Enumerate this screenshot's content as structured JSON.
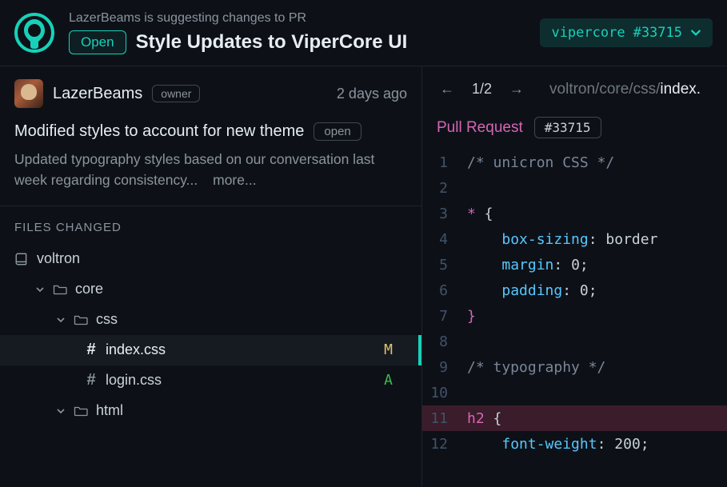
{
  "header": {
    "suggest_line": "LazerBeams is suggesting changes to PR",
    "open_label": "Open",
    "title": "Style Updates to ViperCore UI",
    "branch_name": "vipercore",
    "branch_number": "#33715"
  },
  "author": {
    "name": "LazerBeams",
    "role": "owner",
    "timestamp": "2 days ago"
  },
  "commit": {
    "title": "Modified styles to account for new theme",
    "status": "open",
    "description": "Updated typography styles based on our conversation last week regarding consistency...",
    "more_label": "more..."
  },
  "files": {
    "heading": "FILES CHANGED",
    "tree": {
      "repo": "voltron",
      "core": "core",
      "css": "css",
      "html": "html",
      "index_css": "index.css",
      "login_css": "login.css",
      "index_status": "M",
      "login_status": "A"
    }
  },
  "code_panel": {
    "nav": {
      "prev": "←",
      "counter": "1/2",
      "next": "→",
      "path_prefix": "voltron/core/css/",
      "path_file": "index."
    },
    "pr_label": "Pull Request",
    "pr_number": "#33715",
    "lines": [
      {
        "n": 1,
        "indent": 0,
        "tokens": [
          {
            "c": "tok-comment",
            "t": "/* unicron CSS */"
          }
        ]
      },
      {
        "n": 2,
        "indent": 0,
        "tokens": []
      },
      {
        "n": 3,
        "indent": 0,
        "tokens": [
          {
            "c": "tok-sel",
            "t": "*"
          },
          {
            "c": "tok-punc",
            "t": " {"
          }
        ]
      },
      {
        "n": 4,
        "indent": 1,
        "tokens": [
          {
            "c": "tok-prop",
            "t": "box-sizing"
          },
          {
            "c": "tok-punc",
            "t": ": "
          },
          {
            "c": "tok-val",
            "t": "border"
          }
        ]
      },
      {
        "n": 5,
        "indent": 1,
        "tokens": [
          {
            "c": "tok-prop",
            "t": "margin"
          },
          {
            "c": "tok-punc",
            "t": ": "
          },
          {
            "c": "tok-val",
            "t": "0"
          },
          {
            "c": "tok-punc",
            "t": ";"
          }
        ]
      },
      {
        "n": 6,
        "indent": 1,
        "tokens": [
          {
            "c": "tok-prop",
            "t": "padding"
          },
          {
            "c": "tok-punc",
            "t": ": "
          },
          {
            "c": "tok-val",
            "t": "0"
          },
          {
            "c": "tok-punc",
            "t": ";"
          }
        ]
      },
      {
        "n": 7,
        "indent": 0,
        "tokens": [
          {
            "c": "tok-brace",
            "t": "}"
          }
        ]
      },
      {
        "n": 8,
        "indent": 0,
        "tokens": []
      },
      {
        "n": 9,
        "indent": 0,
        "tokens": [
          {
            "c": "tok-comment",
            "t": "/* typography */"
          }
        ]
      },
      {
        "n": 10,
        "indent": 0,
        "tokens": []
      },
      {
        "n": 11,
        "indent": 0,
        "hl": true,
        "tokens": [
          {
            "c": "tok-sel",
            "t": "h2"
          },
          {
            "c": "tok-punc",
            "t": " {"
          }
        ]
      },
      {
        "n": 12,
        "indent": 1,
        "tokens": [
          {
            "c": "tok-prop",
            "t": "font-weight"
          },
          {
            "c": "tok-punc",
            "t": ": "
          },
          {
            "c": "tok-val",
            "t": "200"
          },
          {
            "c": "tok-punc",
            "t": ";"
          }
        ]
      }
    ]
  }
}
